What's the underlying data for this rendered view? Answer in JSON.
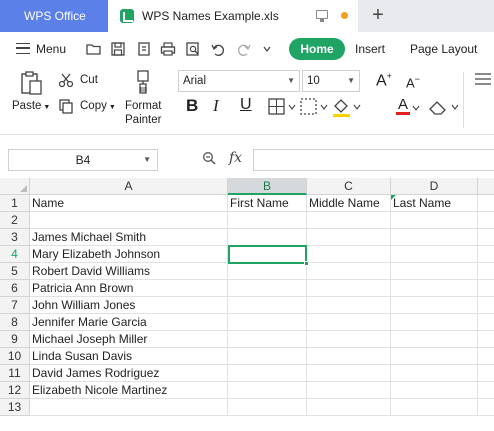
{
  "titlebar": {
    "app_tab": "WPS Office",
    "doc_tab": "WPS Names Example.xls",
    "new_tab": "+"
  },
  "menu": {
    "menu_label": "Menu",
    "tabs": [
      "Home",
      "Insert",
      "Page Layout"
    ],
    "active_tab": "Home"
  },
  "ribbon": {
    "paste": "Paste",
    "cut": "Cut",
    "copy": "Copy",
    "format_painter_line1": "Format",
    "format_painter_line2": "Painter",
    "font_name": "Arial",
    "font_size": "10",
    "bold": "B",
    "italic": "I",
    "underline": "U",
    "font_color_letter": "A",
    "grow_font": "A",
    "shrink_font": "A"
  },
  "colors": {
    "accent_green": "#1fa463",
    "wps_tab_blue": "#5b80e8",
    "highlight_yellow": "#f5d400",
    "font_color_red": "#e02020"
  },
  "formula_bar": {
    "name_box": "B4",
    "fx_label": "fx",
    "formula_value": ""
  },
  "grid": {
    "columns": [
      "A",
      "B",
      "C",
      "D"
    ],
    "active_column": "B",
    "active_row": "4",
    "selected_cell": "B4",
    "rows": [
      {
        "num": "1",
        "A": "Name",
        "B": "First Name",
        "C": "Middle Name",
        "D": "Last Name"
      },
      {
        "num": "2",
        "A": "",
        "B": "",
        "C": "",
        "D": ""
      },
      {
        "num": "3",
        "A": "James Michael Smith",
        "B": "",
        "C": "",
        "D": ""
      },
      {
        "num": "4",
        "A": "Mary Elizabeth Johnson",
        "B": "",
        "C": "",
        "D": ""
      },
      {
        "num": "5",
        "A": "Robert David Williams",
        "B": "",
        "C": "",
        "D": ""
      },
      {
        "num": "6",
        "A": "Patricia Ann Brown",
        "B": "",
        "C": "",
        "D": ""
      },
      {
        "num": "7",
        "A": "John William Jones",
        "B": "",
        "C": "",
        "D": ""
      },
      {
        "num": "8",
        "A": "Jennifer Marie Garcia",
        "B": "",
        "C": "",
        "D": ""
      },
      {
        "num": "9",
        "A": "Michael Joseph Miller",
        "B": "",
        "C": "",
        "D": ""
      },
      {
        "num": "10",
        "A": "Linda Susan Davis",
        "B": "",
        "C": "",
        "D": ""
      },
      {
        "num": "11",
        "A": "David James Rodriguez",
        "B": "",
        "C": "",
        "D": ""
      },
      {
        "num": "12",
        "A": "Elizabeth Nicole Martinez",
        "B": "",
        "C": "",
        "D": ""
      },
      {
        "num": "13",
        "A": "",
        "B": "",
        "C": "",
        "D": ""
      }
    ]
  }
}
